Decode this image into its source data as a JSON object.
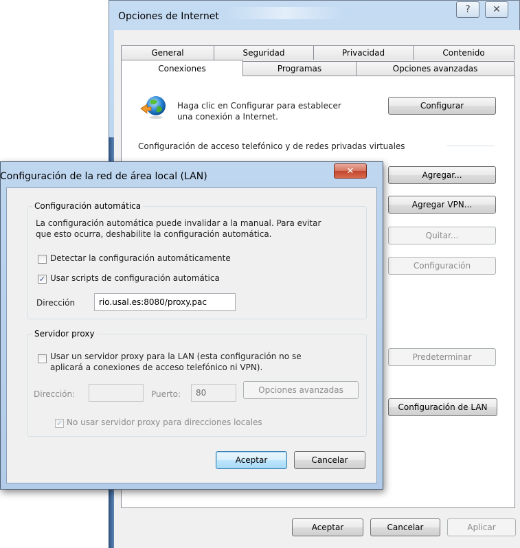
{
  "main_window": {
    "title": "Opciones de Internet",
    "help_glyph": "?",
    "close_glyph": "✕",
    "tabs_row1": [
      "General",
      "Seguridad",
      "Privacidad",
      "Contenido"
    ],
    "tabs_row2": [
      "Conexiones",
      "Programas",
      "Opciones avanzadas"
    ],
    "active_tab": "Conexiones",
    "setup_text_line1": "Haga clic en Configurar para establecer",
    "setup_text_line2": "una conexión a Internet.",
    "setup_button": "Configurar",
    "dialup_section_label": "Configuración de acceso telefónico y de redes privadas virtuales",
    "add_button": "Agregar...",
    "add_vpn_button": "Agregar VPN...",
    "remove_button": "Quitar...",
    "settings_button": "Configuración",
    "default_button": "Predeterminar",
    "lan_settings_button": "Configuración de LAN",
    "ok_button": "Aceptar",
    "cancel_button": "Cancelar",
    "apply_button": "Aplicar"
  },
  "lan_dialog": {
    "title": "Configuración de la red de área local (LAN)",
    "close_glyph": "✕",
    "auto_config": {
      "legend": "Configuración automática",
      "description_line1": "La configuración automática puede invalidar a la manual. Para evitar",
      "description_line2": "que esto ocurra, deshabilite la configuración automática.",
      "detect_label": "Detectar la configuración automáticamente",
      "detect_checked": false,
      "script_label": "Usar scripts de configuración automática",
      "script_checked": true,
      "address_label": "Dirección",
      "address_value": "rio.usal.es:8080/proxy.pac"
    },
    "proxy": {
      "legend": "Servidor proxy",
      "use_proxy_label_line1": "Usar un servidor proxy para la LAN (esta configuración no se",
      "use_proxy_label_line2": "aplicará a conexiones de acceso telefónico ni VPN).",
      "use_proxy_checked": false,
      "address_label": "Dirección:",
      "address_value": "",
      "port_label": "Puerto:",
      "port_value": "80",
      "advanced_button": "Opciones avanzadas",
      "bypass_local_label": "No usar servidor proxy para direcciones locales",
      "bypass_local_checked": true
    },
    "ok_button": "Aceptar",
    "cancel_button": "Cancelar"
  },
  "check_glyph": "✓"
}
